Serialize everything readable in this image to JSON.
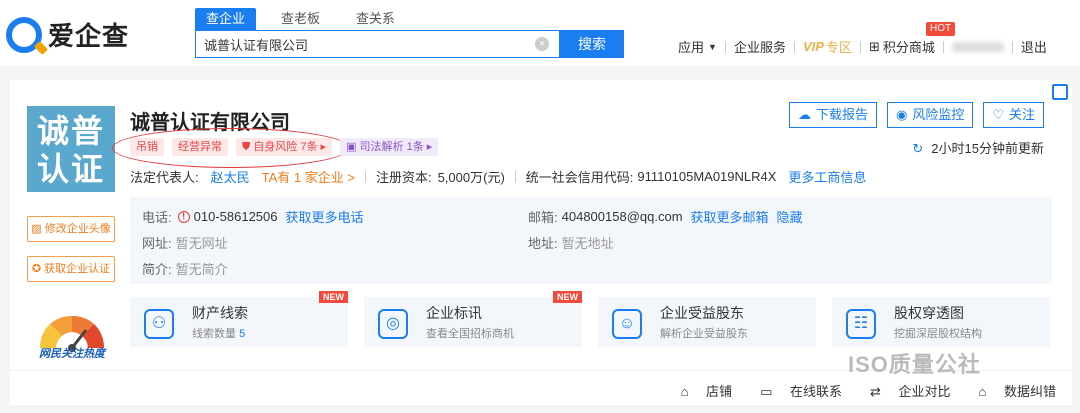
{
  "brand": {
    "name": "爱企查"
  },
  "search": {
    "tabs": [
      "查企业",
      "查老板",
      "查关系"
    ],
    "value": "诚普认证有限公司",
    "button": "搜索"
  },
  "nav": {
    "app": "应用",
    "enterprise_service": "企业服务",
    "vip": "VIP",
    "vip_zone": "专区",
    "points_mall": "积分商城",
    "hot": "HOT",
    "logout": "退出"
  },
  "company": {
    "avatar_text": "诚普\n认证",
    "name": "诚普认证有限公司",
    "tags": [
      "吊销",
      "经营异常",
      "自身风险 7条 ▸",
      "司法解析 1条 ▸"
    ],
    "legal_rep_label": "法定代表人:",
    "legal_rep": "赵太民",
    "legal_rep_more": "TA有 1 家企业 >",
    "capital_label": "注册资本:",
    "capital": "5,000万(元)",
    "credit_label": "统一社会信用代码:",
    "credit_code": "91110105MA019NLR4X",
    "more_info": "更多工商信息"
  },
  "actions": {
    "download": "下载报告",
    "monitor": "风险监控",
    "follow": "关注",
    "updated": "2小时15分钟前更新"
  },
  "side": {
    "edit_avatar": "修改企业头像",
    "get_cert": "获取企业认证",
    "heat": "网民关注热度"
  },
  "contact": {
    "phone_label": "电话:",
    "phone": "010-58612506",
    "phone_more": "获取更多电话",
    "email_label": "邮箱:",
    "email": "404800158@qq.com",
    "email_more": "获取更多邮箱",
    "hide": "隐藏",
    "site_label": "网址:",
    "site": "暂无网址",
    "addr_label": "地址:",
    "addr": "暂无地址",
    "intro_label": "简介:",
    "intro": "暂无简介"
  },
  "features": [
    {
      "title": "财产线索",
      "sub": "线索数量",
      "count": "5",
      "new": "NEW"
    },
    {
      "title": "企业标讯",
      "sub": "查看全国招标商机",
      "new": "NEW"
    },
    {
      "title": "企业受益股东",
      "sub": "解析企业受益股东"
    },
    {
      "title": "股权穿透图",
      "sub": "挖掘深层股权结构"
    }
  ],
  "bottom": {
    "store": "店铺",
    "contact": "在线联系",
    "compare": "企业对比",
    "correct": "数据纠错"
  },
  "watermark": "ISO质量公社"
}
